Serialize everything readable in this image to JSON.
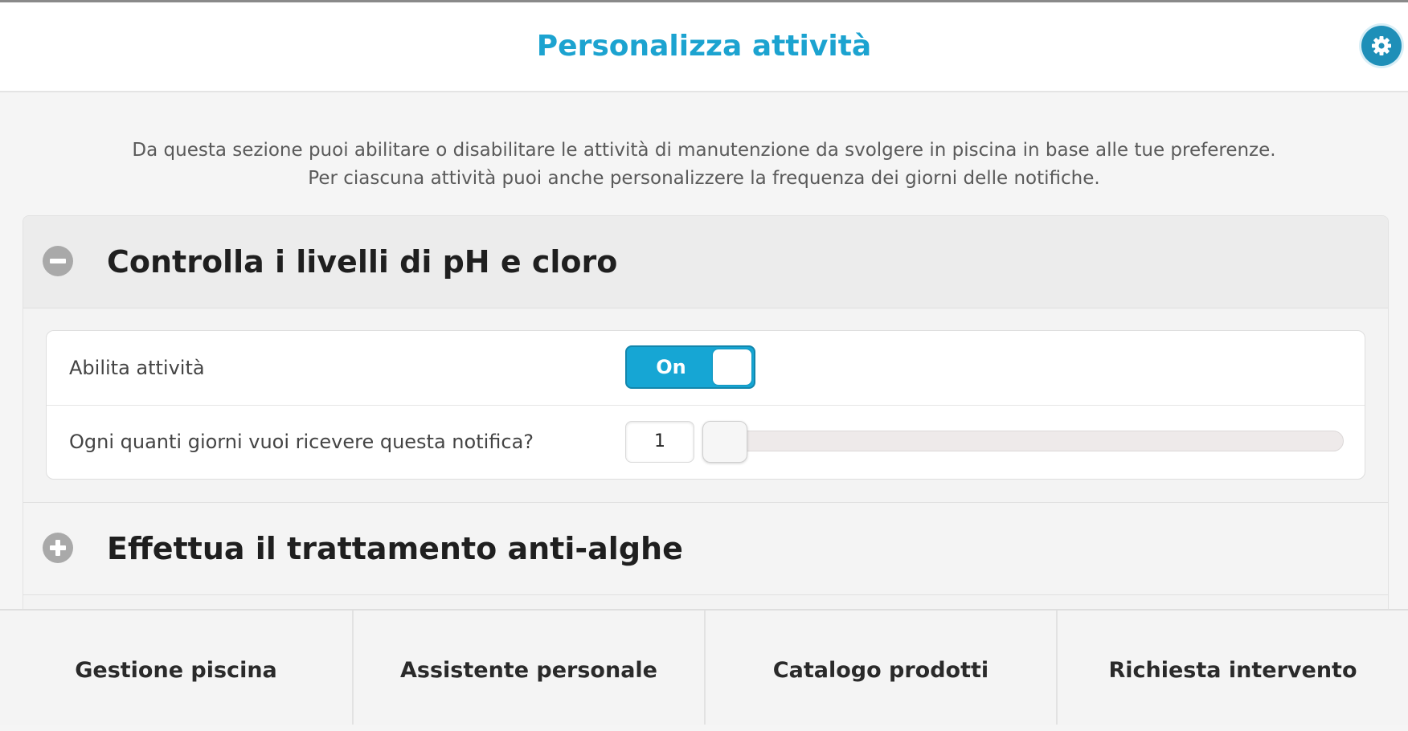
{
  "header": {
    "title": "Personalizza attività",
    "settings_icon": "gear-icon",
    "accent_color": "#1ca3d0"
  },
  "intro": {
    "line1": "Da questa sezione puoi abilitare o disabilitare le attività di manutenzione da svolgere in piscina in base alle tue preferenze.",
    "line2": "Per ciascuna attività puoi anche personalizzere la frequenza dei giorni delle notifiche."
  },
  "activities": [
    {
      "title": "Controlla i livelli di pH e cloro",
      "expanded": true,
      "icon": "minus-circle-icon",
      "enable_label": "Abilita attività",
      "toggle_text": "On",
      "toggle_on": true,
      "frequency_label": "Ogni quanti giorni vuoi ricevere questa notifica?",
      "frequency_value": "1",
      "slider_fraction": 0.0
    },
    {
      "title": "Effettua il trattamento anti-alghe",
      "expanded": false,
      "icon": "plus-circle-icon"
    }
  ],
  "footer": {
    "items": [
      {
        "label": "Gestione piscina"
      },
      {
        "label": "Assistente personale"
      },
      {
        "label": "Catalogo prodotti"
      },
      {
        "label": "Richiesta intervento"
      }
    ]
  }
}
